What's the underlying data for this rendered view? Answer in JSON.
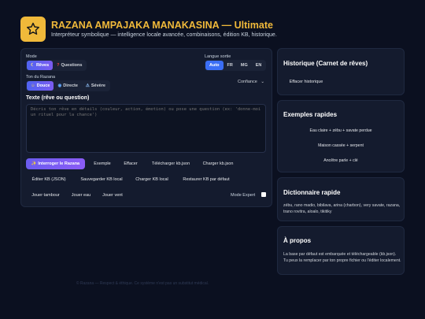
{
  "header": {
    "logo_icon": "star-icon",
    "title": "RAZANA AMPAJAKA MANAKASINA — Ultimate",
    "subtitle": "Interpréteur symbolique — intelligence locale avancée, combinaisons, édition KB, historique."
  },
  "mode": {
    "label": "Mode",
    "options": [
      {
        "label": "Rêves",
        "icon": "moon-icon",
        "active": true
      },
      {
        "label": "Questions",
        "icon": "question-icon",
        "active": false
      }
    ]
  },
  "language": {
    "label": "Langue sortie",
    "options": [
      {
        "label": "Auto",
        "active": true
      },
      {
        "label": "FR",
        "active": false
      },
      {
        "label": "MG",
        "active": false
      },
      {
        "label": "EN",
        "active": false
      }
    ]
  },
  "tone": {
    "label": "Ton du Razana",
    "options": [
      {
        "label": "Douce",
        "icon": "smile-icon",
        "active": true
      },
      {
        "label": "Directe",
        "icon": "target-icon",
        "active": false
      },
      {
        "label": "Sévère",
        "icon": "warning-icon",
        "active": false
      }
    ]
  },
  "confidence": {
    "label": "Confiance"
  },
  "text_input": {
    "label": "Texte (rêve ou question)",
    "placeholder": "Décris ton rêve en détails (couleur, action, émotion) ou pose une question (ex: 'donne-moi un rituel pour la chance')"
  },
  "actions": {
    "interrogate": "✨ Interroger le Razana",
    "example": "Exemple",
    "clear": "Effacer",
    "download_kb": "Télécharger kb.json",
    "load_kb": "Charger kb.json",
    "edit_kb": "Éditer KB (JSON)",
    "save_kb": "Sauvegarder KB local",
    "load_local_kb": "Charger KB local",
    "restore_kb": "Restaurer KB par défaut",
    "play_drum": "Jouer tambour",
    "play_water": "Jouer eau",
    "play_wind": "Jouer vent",
    "expert_mode": "Mode Expert"
  },
  "history": {
    "title": "Historique (Carnet de rêves)",
    "clear_button": "Effacer historique"
  },
  "examples": {
    "title": "Exemples rapides",
    "items": [
      "Eau claire + zébu + savate perdue",
      "Maison cassée + serpent",
      "Ancêtre parle + clé"
    ]
  },
  "dictionary": {
    "title": "Dictionnaire rapide",
    "text": "zébu, rano madio, bibilava, arina (charbon), very savate, razana, trano rovitra, aloalo, tikitiky"
  },
  "about": {
    "title": "À propos",
    "text": "La base par défaut est embarquée et téléchargeable (kb.json). Tu peux la remplacer par ton propre fichier ou l'éditer localement."
  },
  "footer": "© Razana — Respect & éthique. Ce système n'est pas un substitut médical."
}
